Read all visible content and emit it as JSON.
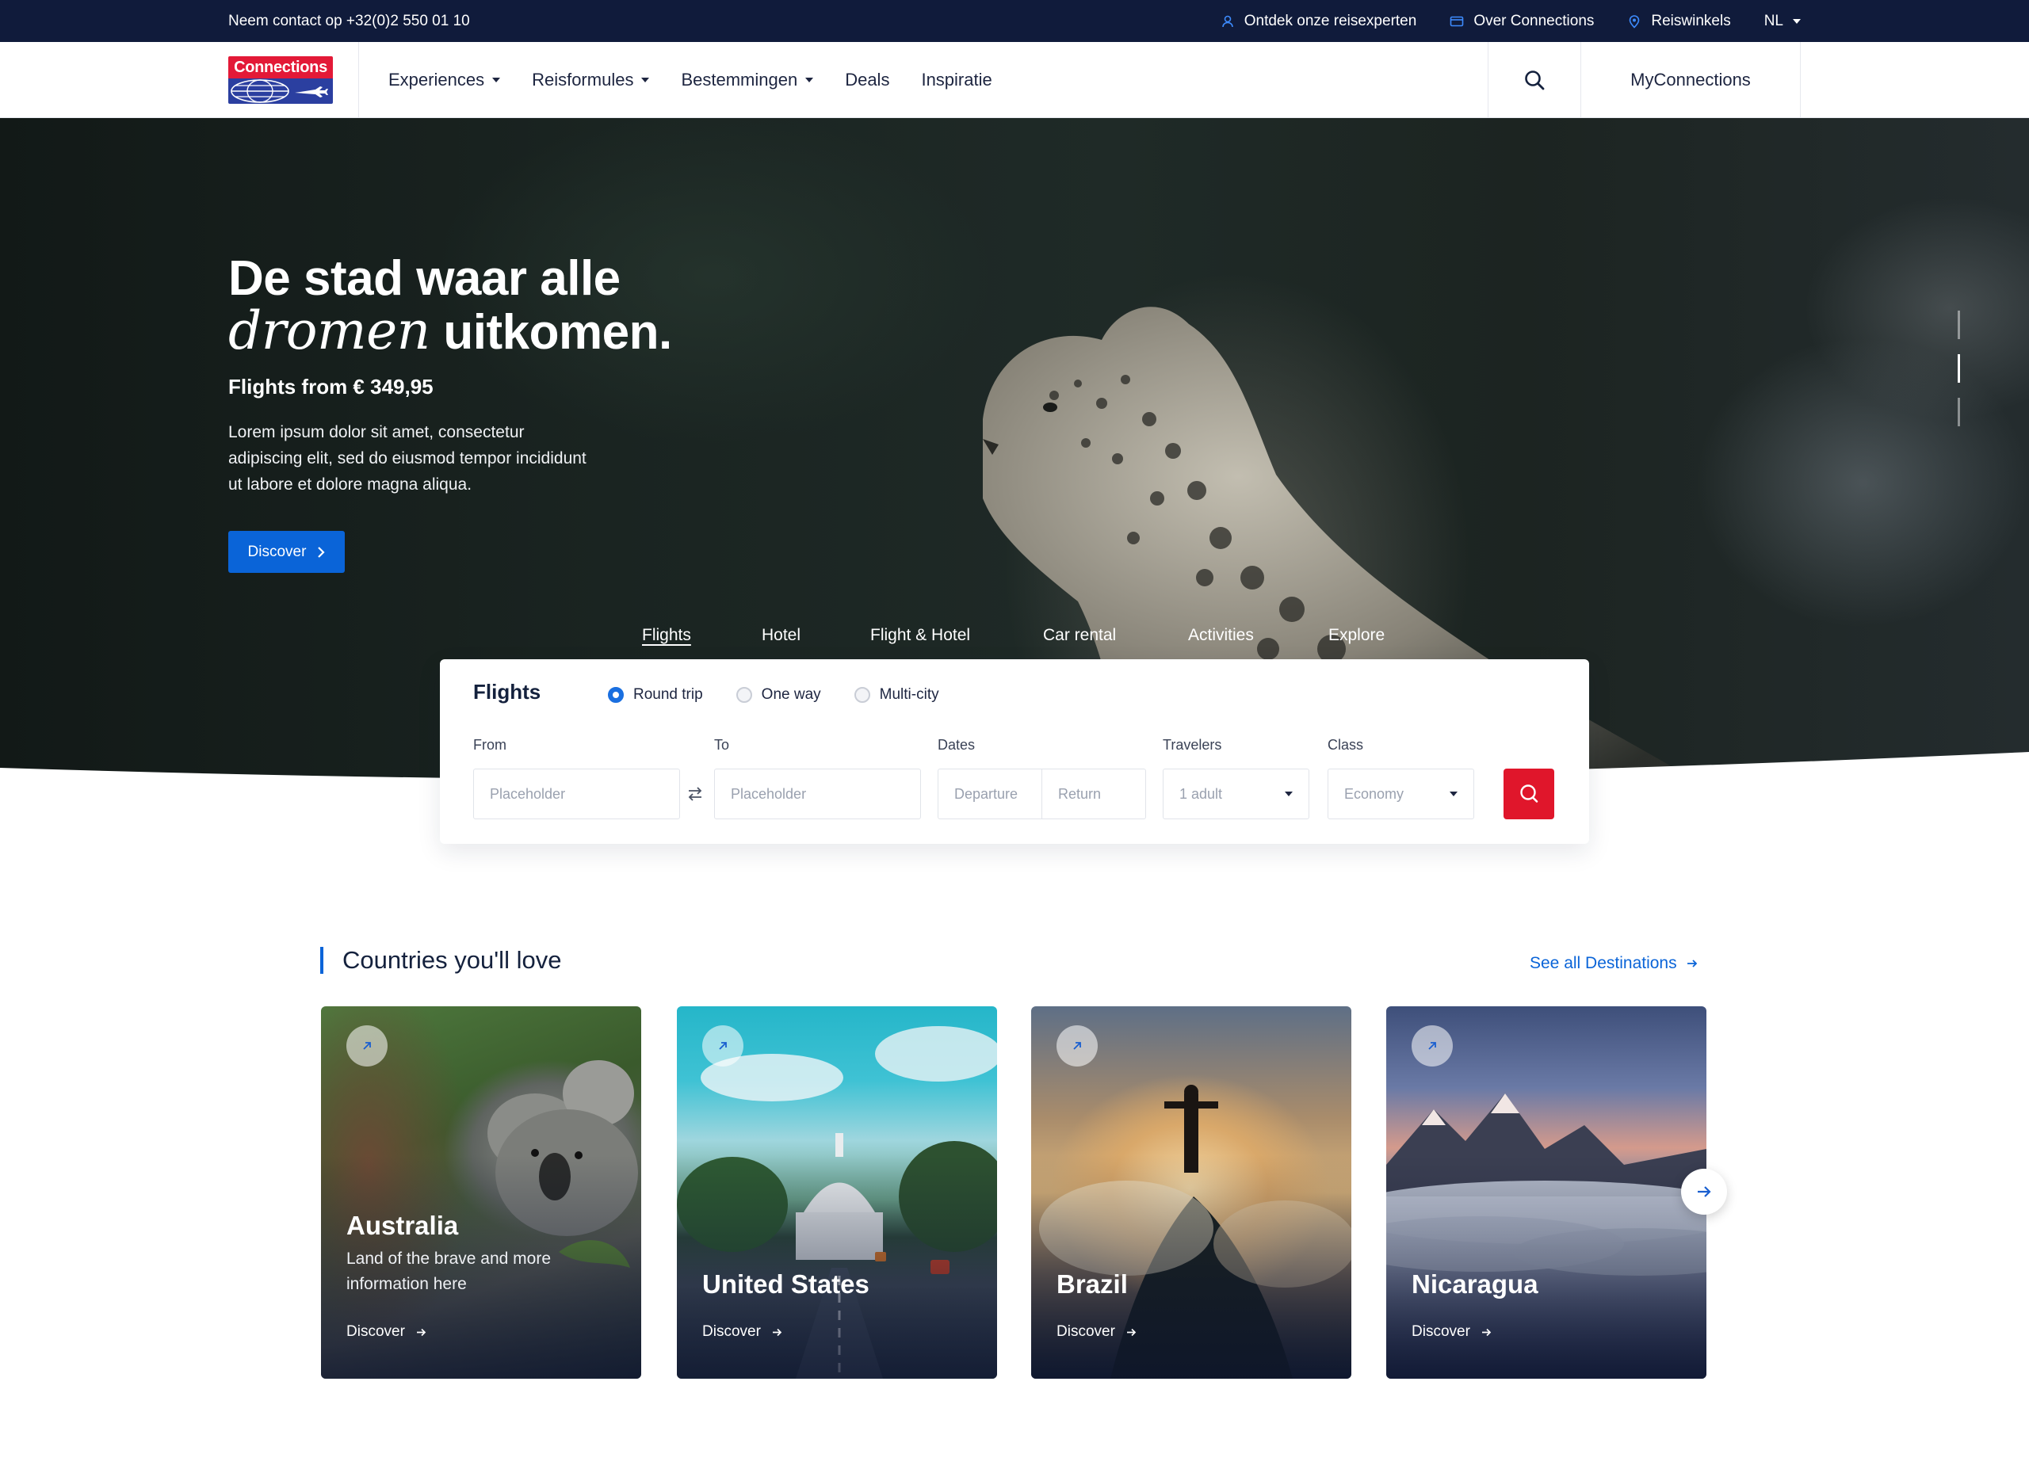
{
  "topbar": {
    "contact": "Neem contact op +32(0)2 550 01 10",
    "links": [
      "Ontdek onze reisexperten",
      "Over Connections",
      "Reiswinkels"
    ],
    "language": "NL"
  },
  "nav": {
    "logo_text": "Connections",
    "menu": [
      "Experiences",
      "Reisformules",
      "Bestemmingen",
      "Deals",
      "Inspiratie"
    ],
    "account": "MyConnections"
  },
  "hero": {
    "title_line1": "De stad waar alle",
    "title_script": "dromen",
    "title_rest": " uitkomen.",
    "price": "Flights from € 349,95",
    "description": "Lorem ipsum dolor sit amet, consectetur adipiscing elit, sed do eiusmod tempor incididunt ut labore et dolore magna aliqua.",
    "button": "Discover"
  },
  "search": {
    "tabs": [
      "Flights",
      "Hotel",
      "Flight & Hotel",
      "Car rental",
      "Activities",
      "Explore"
    ],
    "active_tab": "Flights",
    "title": "Flights",
    "trip_types": [
      "Round trip",
      "One way",
      "Multi-city"
    ],
    "selected_trip": "Round trip",
    "labels": {
      "from": "From",
      "to": "To",
      "dates": "Dates",
      "travelers": "Travelers",
      "class": "Class"
    },
    "from_placeholder": "Placeholder",
    "to_placeholder": "Placeholder",
    "departure_placeholder": "Departure",
    "return_placeholder": "Return",
    "travelers_value": "1 adult",
    "class_value": "Economy"
  },
  "countries": {
    "title": "Countries you'll love",
    "see_all": "See all Destinations",
    "cards": [
      {
        "name": "Australia",
        "description": "Land of the brave and more information here",
        "cta": "Discover"
      },
      {
        "name": "United States",
        "description": "",
        "cta": "Discover"
      },
      {
        "name": "Brazil",
        "description": "",
        "cta": "Discover"
      },
      {
        "name": "Nicaragua",
        "description": "",
        "cta": "Discover"
      }
    ]
  },
  "colors": {
    "topbar": "#101b3b",
    "primary_blue": "#0a64d8",
    "search_red": "#e0162b",
    "logo_red": "#e31937",
    "logo_blue": "#2b3fa0"
  }
}
